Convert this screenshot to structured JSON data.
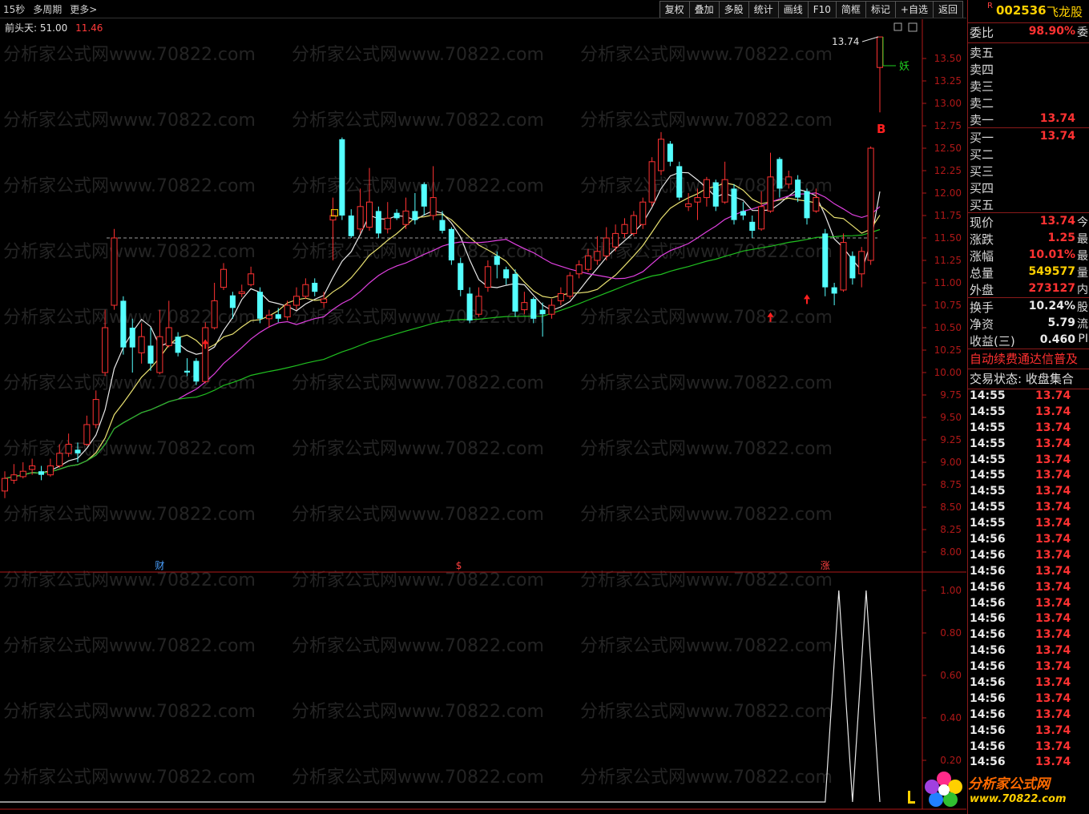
{
  "toolbar": {
    "left": [
      "15秒",
      "多周期",
      "更多>"
    ],
    "right": [
      "复权",
      "叠加",
      "多股",
      "统计",
      "画线",
      "F10",
      "简框",
      "标记",
      "+自选",
      "返回"
    ]
  },
  "indicator": {
    "name": "前头天:",
    "value1": "51.00",
    "value2": "11.46"
  },
  "main_chart": {
    "y_ticks": [
      "13.50",
      "13.25",
      "13.00",
      "12.75",
      "12.50",
      "12.25",
      "12.00",
      "11.75",
      "11.50",
      "11.25",
      "11.00",
      "10.75",
      "10.50",
      "10.25",
      "10.00",
      "9.75",
      "9.50",
      "9.25",
      "9.00",
      "8.75",
      "8.50",
      "8.25",
      "8.00"
    ],
    "high_label": "13.74",
    "yao_label": "妖",
    "b_label": "B",
    "ref_price": 11.5,
    "bottom_markers": [
      "财",
      "$",
      "涨"
    ],
    "candles": [
      [
        8.68,
        8.82,
        8.9,
        8.6
      ],
      [
        8.8,
        8.86,
        8.98,
        8.76
      ],
      [
        8.84,
        8.9,
        9.0,
        8.82
      ],
      [
        8.92,
        8.96,
        9.04,
        8.86
      ],
      [
        8.9,
        8.86,
        8.96,
        8.8
      ],
      [
        8.86,
        8.96,
        9.04,
        8.84
      ],
      [
        8.96,
        9.1,
        9.2,
        8.94
      ],
      [
        9.1,
        9.2,
        9.32,
        9.06
      ],
      [
        9.14,
        9.1,
        9.22,
        9.0
      ],
      [
        9.2,
        9.42,
        9.52,
        9.18
      ],
      [
        9.42,
        9.7,
        9.8,
        9.38
      ],
      [
        10.0,
        10.5,
        10.7,
        9.96
      ],
      [
        10.75,
        11.5,
        11.6,
        10.7
      ],
      [
        10.8,
        10.28,
        10.85,
        10.2
      ],
      [
        10.5,
        10.28,
        10.6,
        10.0
      ],
      [
        10.22,
        10.4,
        10.55,
        10.1
      ],
      [
        10.3,
        10.1,
        10.5,
        10.02
      ],
      [
        10.0,
        10.4,
        10.7,
        9.98
      ],
      [
        10.3,
        10.5,
        10.8,
        10.28
      ],
      [
        10.4,
        10.22,
        10.45,
        10.18
      ],
      [
        10.02,
        10.0,
        10.16,
        9.96
      ],
      [
        10.13,
        9.9,
        10.16,
        9.86
      ],
      [
        9.9,
        10.5,
        10.56,
        9.88
      ],
      [
        10.5,
        10.8,
        11.0,
        10.48
      ],
      [
        10.95,
        11.15,
        11.22,
        10.92
      ],
      [
        10.86,
        10.72,
        10.9,
        10.6
      ],
      [
        10.88,
        10.9,
        10.98,
        10.84
      ],
      [
        10.98,
        11.1,
        11.18,
        10.96
      ],
      [
        10.9,
        10.6,
        10.95,
        10.55
      ],
      [
        10.6,
        10.64,
        10.7,
        10.5
      ],
      [
        10.65,
        10.6,
        10.72,
        10.56
      ],
      [
        10.62,
        10.75,
        10.8,
        10.58
      ],
      [
        10.75,
        10.85,
        10.95,
        10.7
      ],
      [
        10.85,
        10.98,
        11.05,
        10.82
      ],
      [
        11.0,
        10.9,
        11.05,
        10.85
      ],
      [
        10.78,
        10.82,
        10.9,
        10.72
      ],
      [
        11.7,
        11.75,
        11.95,
        11.25
      ],
      [
        12.6,
        11.75,
        12.62,
        11.7
      ],
      [
        11.75,
        11.52,
        11.82,
        11.5
      ],
      [
        11.6,
        11.85,
        12.05,
        11.55
      ],
      [
        11.62,
        11.9,
        12.28,
        11.58
      ],
      [
        11.8,
        11.55,
        11.85,
        11.5
      ],
      [
        11.6,
        11.72,
        11.9,
        11.55
      ],
      [
        11.78,
        11.72,
        11.82,
        11.7
      ],
      [
        11.65,
        11.8,
        11.95,
        11.6
      ],
      [
        11.8,
        11.7,
        12.0,
        11.65
      ],
      [
        12.1,
        11.85,
        12.12,
        11.75
      ],
      [
        11.75,
        11.95,
        12.3,
        11.7
      ],
      [
        11.7,
        11.58,
        11.8,
        11.55
      ],
      [
        11.6,
        11.25,
        11.62,
        11.2
      ],
      [
        11.22,
        10.92,
        11.28,
        10.85
      ],
      [
        10.88,
        10.58,
        10.95,
        10.55
      ],
      [
        10.65,
        10.85,
        10.95,
        10.62
      ],
      [
        10.95,
        11.18,
        11.25,
        10.9
      ],
      [
        11.3,
        11.2,
        11.35,
        11.05
      ],
      [
        11.15,
        11.05,
        11.18,
        10.98
      ],
      [
        11.1,
        10.68,
        11.15,
        10.62
      ],
      [
        10.7,
        10.78,
        10.9,
        10.65
      ],
      [
        10.82,
        10.6,
        10.84,
        10.55
      ],
      [
        10.7,
        10.65,
        10.78,
        10.4
      ],
      [
        10.65,
        10.75,
        10.82,
        10.6
      ],
      [
        10.8,
        10.88,
        10.95,
        10.75
      ],
      [
        10.85,
        11.08,
        11.12,
        10.82
      ],
      [
        11.1,
        11.2,
        11.25,
        11.05
      ],
      [
        11.15,
        11.3,
        11.38,
        11.12
      ],
      [
        11.25,
        11.35,
        11.52,
        11.2
      ],
      [
        11.3,
        11.5,
        11.62,
        11.25
      ],
      [
        11.4,
        11.55,
        11.65,
        11.35
      ],
      [
        11.55,
        11.65,
        11.72,
        11.5
      ],
      [
        11.55,
        11.75,
        11.8,
        11.52
      ],
      [
        11.65,
        11.9,
        11.95,
        11.6
      ],
      [
        11.9,
        12.35,
        12.4,
        11.85
      ],
      [
        12.25,
        12.6,
        12.68,
        12.2
      ],
      [
        12.55,
        12.35,
        12.58,
        12.3
      ],
      [
        12.3,
        11.95,
        12.35,
        11.92
      ],
      [
        11.85,
        11.88,
        12.0,
        11.8
      ],
      [
        11.9,
        11.95,
        12.05,
        11.7
      ],
      [
        11.95,
        12.15,
        12.18,
        11.85
      ],
      [
        12.12,
        11.85,
        12.15,
        11.8
      ],
      [
        11.9,
        12.15,
        12.35,
        11.88
      ],
      [
        12.05,
        11.7,
        12.1,
        11.65
      ],
      [
        11.8,
        11.75,
        11.9,
        11.7
      ],
      [
        11.68,
        11.58,
        11.75,
        11.5
      ],
      [
        11.6,
        11.85,
        12.02,
        11.58
      ],
      [
        11.8,
        12.18,
        12.45,
        11.78
      ],
      [
        12.38,
        12.05,
        12.4,
        11.95
      ],
      [
        12.1,
        12.18,
        12.25,
        12.05
      ],
      [
        12.15,
        11.95,
        12.2,
        11.9
      ],
      [
        12.02,
        11.72,
        12.05,
        11.65
      ],
      [
        11.8,
        11.95,
        12.05,
        11.78
      ],
      [
        11.55,
        10.95,
        11.6,
        10.85
      ],
      [
        10.95,
        10.88,
        11.0,
        10.75
      ],
      [
        10.92,
        11.45,
        11.55,
        10.9
      ],
      [
        11.3,
        11.05,
        11.35,
        10.98
      ],
      [
        11.1,
        11.35,
        11.4,
        10.95
      ],
      [
        11.25,
        12.5,
        12.52,
        11.2
      ],
      [
        13.4,
        13.74,
        13.74,
        12.9
      ]
    ]
  },
  "sub_chart": {
    "y_ticks": [
      "1.00",
      "0.80",
      "0.60",
      "0.40",
      "0.20"
    ],
    "peaks": [
      0.0,
      1.0,
      0.0,
      1.0,
      0.0
    ]
  },
  "panel": {
    "stock": {
      "mark": "R",
      "code": "002536",
      "name": "飞龙股"
    },
    "weibi": {
      "label": "委比",
      "value": "98.90%",
      "suffix": "委"
    },
    "asks": [
      {
        "label": "卖五",
        "price": ""
      },
      {
        "label": "卖四",
        "price": ""
      },
      {
        "label": "卖三",
        "price": ""
      },
      {
        "label": "卖二",
        "price": ""
      },
      {
        "label": "卖一",
        "price": "13.74"
      }
    ],
    "bids": [
      {
        "label": "买一",
        "price": "13.74"
      },
      {
        "label": "买二",
        "price": ""
      },
      {
        "label": "买三",
        "price": ""
      },
      {
        "label": "买四",
        "price": ""
      },
      {
        "label": "买五",
        "price": ""
      }
    ],
    "quotes": [
      {
        "label": "现价",
        "value": "13.74",
        "suffix": "今",
        "color": "red"
      },
      {
        "label": "涨跌",
        "value": "1.25",
        "suffix": "最",
        "color": "red"
      },
      {
        "label": "涨幅",
        "value": "10.01%",
        "suffix": "最",
        "color": "red"
      },
      {
        "label": "总量",
        "value": "549577",
        "suffix": "量",
        "color": "yellow"
      },
      {
        "label": "外盘",
        "value": "273127",
        "suffix": "内",
        "color": "red"
      }
    ],
    "stats": [
      {
        "label": "换手",
        "value": "10.24%",
        "suffix": "股"
      },
      {
        "label": "净资",
        "value": "5.79",
        "suffix": "流"
      },
      {
        "label": "收益(三)",
        "value": "0.460",
        "suffix": "PI"
      }
    ],
    "notice": "自动续费通达信普及",
    "status": "交易状态: 收盘集合",
    "ticks": [
      {
        "time": "14:55",
        "price": "13.74"
      },
      {
        "time": "14:55",
        "price": "13.74"
      },
      {
        "time": "14:55",
        "price": "13.74"
      },
      {
        "time": "14:55",
        "price": "13.74"
      },
      {
        "time": "14:55",
        "price": "13.74"
      },
      {
        "time": "14:55",
        "price": "13.74"
      },
      {
        "time": "14:55",
        "price": "13.74"
      },
      {
        "time": "14:55",
        "price": "13.74"
      },
      {
        "time": "14:55",
        "price": "13.74"
      },
      {
        "time": "14:56",
        "price": "13.74"
      },
      {
        "time": "14:56",
        "price": "13.74"
      },
      {
        "time": "14:56",
        "price": "13.74"
      },
      {
        "time": "14:56",
        "price": "13.74"
      },
      {
        "time": "14:56",
        "price": "13.74"
      },
      {
        "time": "14:56",
        "price": "13.74"
      },
      {
        "time": "14:56",
        "price": "13.74"
      },
      {
        "time": "14:56",
        "price": "13.74"
      },
      {
        "time": "14:56",
        "price": "13.74"
      },
      {
        "time": "14:56",
        "price": "13.74"
      },
      {
        "time": "14:56",
        "price": "13.74"
      },
      {
        "time": "14:56",
        "price": "13.74"
      },
      {
        "time": "14:56",
        "price": "13.74"
      },
      {
        "time": "14:56",
        "price": "13.74"
      },
      {
        "time": "14:56",
        "price": "13.74"
      }
    ]
  },
  "watermark": "分析家公式网www.70822.com",
  "logo": {
    "brand": "分析家公式网",
    "url": "www.70822.com"
  },
  "colors": {
    "up": "#ff3232",
    "down": "#54ffff",
    "ma5": "#e8e8e8",
    "ma10": "#e8e070",
    "ma20": "#e040e0",
    "ma60": "#20c020",
    "frame": "#b01818"
  }
}
